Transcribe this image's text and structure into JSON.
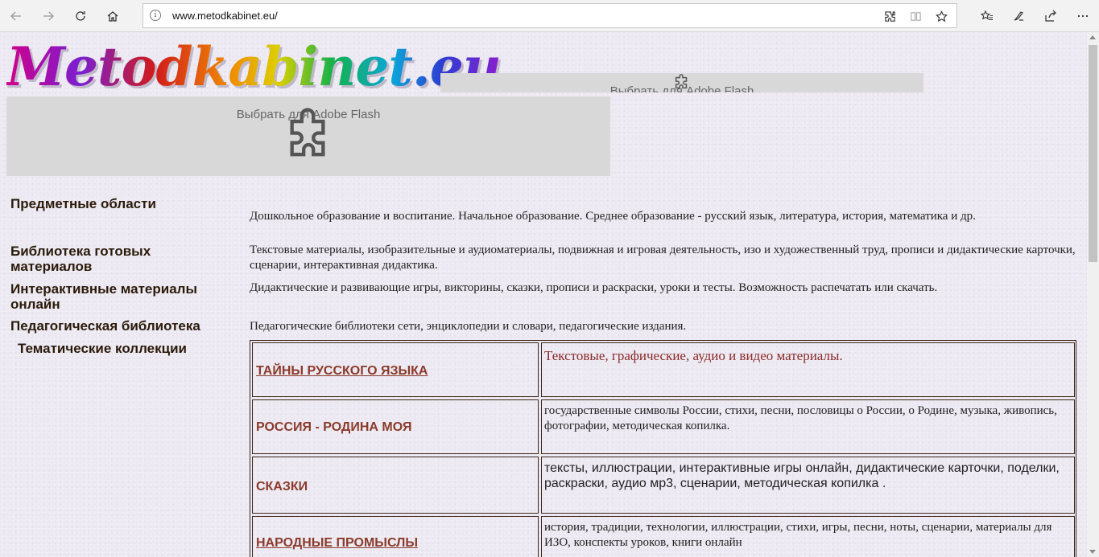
{
  "browser": {
    "url": "www.metodkabinet.eu/",
    "icons": [
      "back-icon",
      "forward-icon",
      "refresh-icon",
      "home-icon",
      "info-icon",
      "extensions-icon",
      "reading-view-icon",
      "favorite-star-icon",
      "favorites-hub-icon",
      "pen-icon",
      "share-icon",
      "more-icon"
    ]
  },
  "logo": {
    "text": "Metodkabinet.eu"
  },
  "flash": {
    "small_label": "Выбрать для Adobe Flash",
    "large_label": "Выбрать для Adobe Flash"
  },
  "nav": {
    "items": [
      {
        "label": "Предметные области"
      },
      {
        "label": "Библиотека готовых материалов"
      },
      {
        "label": "Интерактивные материалы онлайн"
      },
      {
        "label": "Педагогическая библиотека"
      },
      {
        "label": "Тематические коллекции"
      }
    ]
  },
  "descriptions": [
    "Дошкольное образование и воспитание. Начальное образование. Среднее образование - русский язык, литература, история, математика и др.",
    "Текстовые материалы, изобразительные и аудиоматериалы, подвижная и игровая деятельность, изо и художественный труд, прописи и дидактические карточки, сценарии, интерактивная дидактика.",
    "Дидактические и развивающие игры, викторины, сказки, прописи и раскраски, уроки и тесты. Возможность распечатать или скачать.",
    "Педагогические библиотеки сети, энциклопедии и словари, педагогические издания."
  ],
  "collections": [
    {
      "title": "ТАЙНЫ РУССКОГО ЯЗЫКА",
      "desc": "Текстовые, графические, аудио и видео материалы."
    },
    {
      "title": "РОССИЯ - РОДИНА МОЯ",
      "desc": "государственные символы России, стихи, песни, пословицы о России, о Родине, музыка, живопись, фотографии, методическая копилка."
    },
    {
      "title": "СКАЗКИ",
      "desc": "тексты, иллюстрации, интерактивные игры онлайн, дидактические карточки, поделки, раскраски, аудио мр3, сценарии, методическая копилка ."
    },
    {
      "title": "НАРОДНЫЕ ПРОМЫСЛЫ ",
      "desc": "история, традиции, технологии, иллюстрации, стихи, игры, песни, ноты, сценарии, материалы для ИЗО, конспекты уроков, книги онлайн"
    }
  ]
}
